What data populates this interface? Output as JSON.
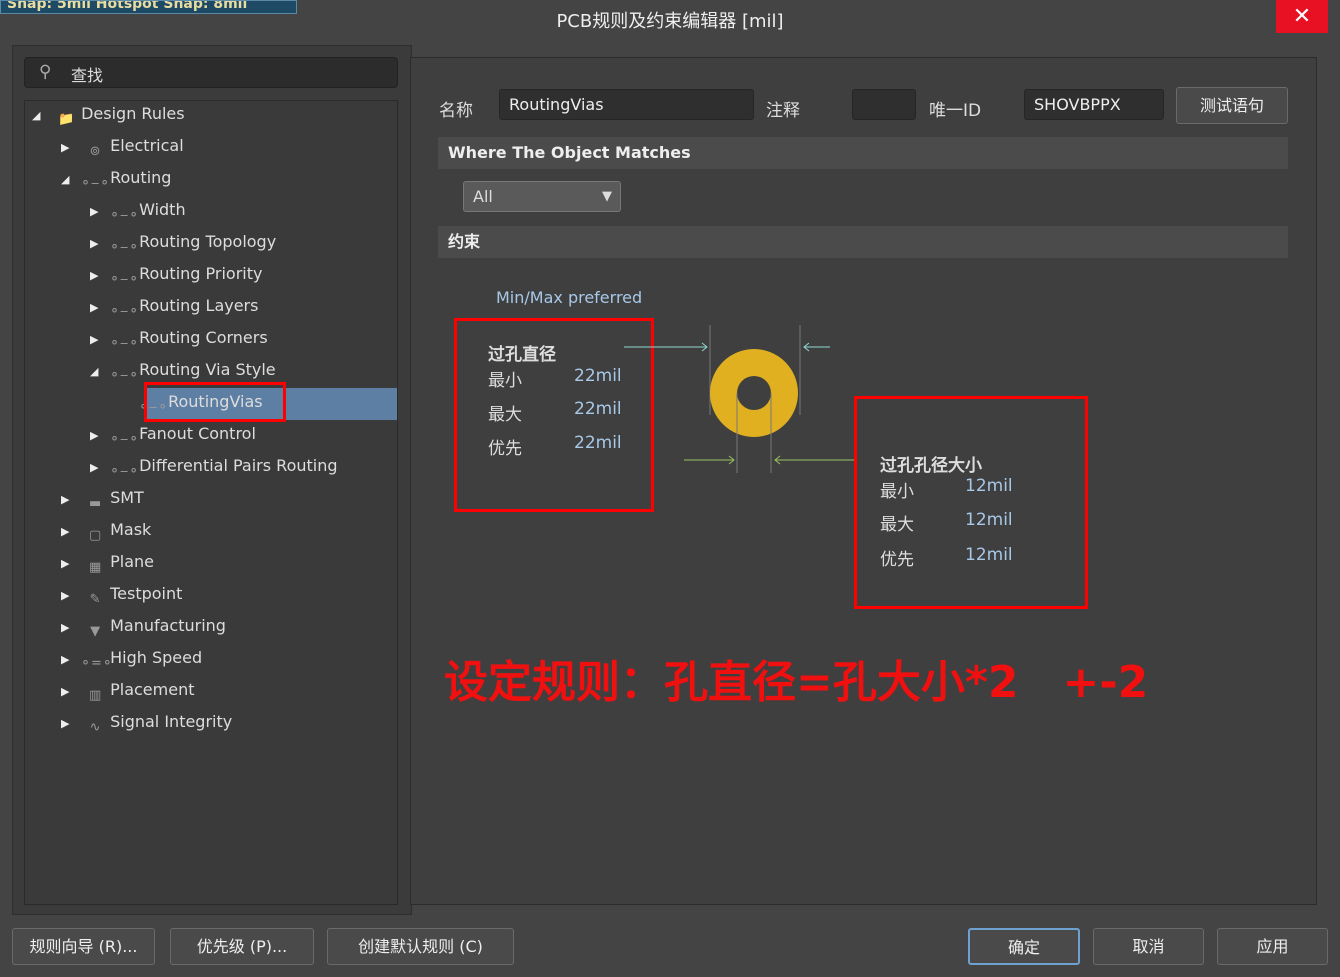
{
  "snap_bar": "Snap: 5mil Hotspot Snap: 8mil",
  "window": {
    "title": "PCB规则及约束编辑器 [mil]",
    "close": "✕"
  },
  "search": {
    "placeholder": "查找"
  },
  "tree": [
    {
      "label": "Design Rules",
      "icon": "folder-icon",
      "expanded": true
    },
    {
      "label": "Electrical",
      "icon": "electrical-icon"
    },
    {
      "label": "Routing",
      "icon": "routing-icon",
      "expanded": true
    },
    {
      "label": "Width",
      "icon": "routing-icon"
    },
    {
      "label": "Routing Topology",
      "icon": "routing-icon"
    },
    {
      "label": "Routing Priority",
      "icon": "routing-icon"
    },
    {
      "label": "Routing Layers",
      "icon": "routing-icon"
    },
    {
      "label": "Routing Corners",
      "icon": "routing-icon"
    },
    {
      "label": "Routing Via Style",
      "icon": "routing-icon",
      "expanded": true
    },
    {
      "label": "RoutingVias",
      "icon": "routing-icon",
      "selected": true
    },
    {
      "label": "Fanout Control",
      "icon": "routing-icon"
    },
    {
      "label": "Differential Pairs Routing",
      "icon": "routing-icon"
    },
    {
      "label": "SMT",
      "icon": "smt-icon"
    },
    {
      "label": "Mask",
      "icon": "mask-icon"
    },
    {
      "label": "Plane",
      "icon": "plane-icon"
    },
    {
      "label": "Testpoint",
      "icon": "testpoint-icon"
    },
    {
      "label": "Manufacturing",
      "icon": "manufacturing-icon"
    },
    {
      "label": "High Speed",
      "icon": "high-speed-icon"
    },
    {
      "label": "Placement",
      "icon": "placement-icon"
    },
    {
      "label": "Signal Integrity",
      "icon": "signal-integrity-icon"
    }
  ],
  "rule": {
    "name_label": "名称",
    "name": "RoutingVias",
    "comment_label": "注释",
    "comment": "",
    "id_label": "唯一ID",
    "id": "SHOVBPPX",
    "test_button": "测试语句"
  },
  "match": {
    "header": "Where The Object Matches",
    "selected": "All"
  },
  "constraints": {
    "header": "约束",
    "mode": "Min/Max preferred",
    "diameter": {
      "title": "过孔直径",
      "min_label": "最小",
      "min": "22mil",
      "max_label": "最大",
      "max": "22mil",
      "pref_label": "优先",
      "pref": "22mil"
    },
    "hole": {
      "title": "过孔孔径大小",
      "min_label": "最小",
      "min": "12mil",
      "max_label": "最大",
      "max": "12mil",
      "pref_label": "优先",
      "pref": "12mil"
    },
    "via_color": "#e0b020"
  },
  "annotation": "设定规则：孔直径=孔大小*2　+-2",
  "buttons": {
    "wizard": "规则向导 (R)...",
    "priority": "优先级 (P)...",
    "default": "创建默认规则 (C)",
    "ok": "确定",
    "cancel": "取消",
    "apply": "应用"
  }
}
